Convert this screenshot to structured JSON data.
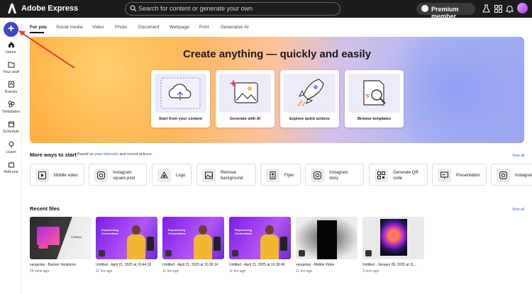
{
  "topbar": {
    "brand": "Adobe Express",
    "search_placeholder": "Search for content or generate your own",
    "premium_label": "Premium member"
  },
  "rail": {
    "items": [
      {
        "label": "Home"
      },
      {
        "label": "Your stuff"
      },
      {
        "label": "Brands"
      },
      {
        "label": "Templates"
      },
      {
        "label": "Schedule"
      },
      {
        "label": "Learn"
      },
      {
        "label": "Add-ons"
      }
    ]
  },
  "tabs": [
    "For you",
    "Social media",
    "Video",
    "Photo",
    "Document",
    "Webpage",
    "Print",
    "Generative AI"
  ],
  "hero": {
    "title": "Create anything — quickly and easily",
    "cards": [
      {
        "label": "Start from your content",
        "icon": "cloud-upload-icon"
      },
      {
        "label": "Generate with AI",
        "icon": "ai-image-icon"
      },
      {
        "label": "Explore quick actions",
        "icon": "rocket-icon"
      },
      {
        "label": "Browse templates",
        "icon": "template-search-icon"
      }
    ]
  },
  "more_ways": {
    "title": "More ways to start",
    "subtitle_pre": "Based on your",
    "subtitle_link": "interests",
    "subtitle_post": "and recent actions.",
    "view_all": "View all",
    "actions": [
      {
        "label": "Mobile video",
        "icon": "play-icon"
      },
      {
        "label": "Instagram square post",
        "icon": "instagram-icon"
      },
      {
        "label": "Logo",
        "icon": "logo-icon"
      },
      {
        "label": "Remove background",
        "icon": "remove-bg-icon"
      },
      {
        "label": "Flyer",
        "icon": "flyer-icon"
      },
      {
        "label": "Instagram story",
        "icon": "instagram-icon"
      },
      {
        "label": "Generate QR code",
        "icon": "qr-code-icon"
      },
      {
        "label": "Presentation",
        "icon": "presentation-icon"
      },
      {
        "label": "Instagram",
        "icon": "instagram-icon"
      }
    ]
  },
  "recent": {
    "title": "Recent files",
    "view_all": "View all",
    "files": [
      {
        "name": "vangeluw - Banner Variations",
        "date": "25 mins ago",
        "thumb_text": "Chillified"
      },
      {
        "name": "Untitled - April 21, 2025 at 10.44.32",
        "date": "11 hrs ago",
        "thumb_text": "Empowering Connections"
      },
      {
        "name": "Untitled - April 21, 2025 at 10.39.14",
        "date": "11 hrs ago",
        "thumb_text": "Empowering Connections"
      },
      {
        "name": "Untitled - April 21, 2025 at 10.38.49",
        "date": "11 hrs ago",
        "thumb_text": "Empowering Connections"
      },
      {
        "name": "vangeluw - Mobile Video",
        "date": "11 hrs ago",
        "thumb_text": ""
      },
      {
        "name": "Untitled - January 09, 2025 at 11...",
        "date": "3 mos ago",
        "thumb_text": ""
      }
    ]
  },
  "colors": {
    "topbar": "#1c1c1c",
    "accent": "#4046ca",
    "link": "#3a5ae0",
    "annotation_arrow": "#e5342a"
  }
}
